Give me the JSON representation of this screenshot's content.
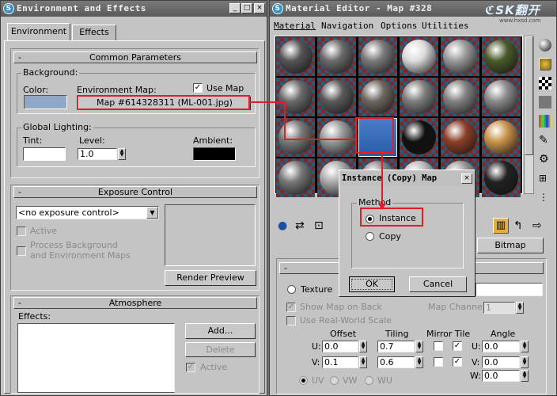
{
  "env": {
    "title": "Environment and Effects",
    "tabs": [
      "Environment",
      "Effects"
    ],
    "common": {
      "header": "Common Parameters",
      "background_group": "Background:",
      "color_label": "Color:",
      "env_map_label": "Environment Map:",
      "use_map_label": "Use Map",
      "use_map_checked": true,
      "map_button": "Map #614328311 (ML-001.jpg)",
      "global_lighting_group": "Global Lighting:",
      "tint_label": "Tint:",
      "level_label": "Level:",
      "level_value": "1.0",
      "ambient_label": "Ambient:",
      "bg_color": "#8fa8c8",
      "tint_color": "#ffffff",
      "ambient_color": "#000000"
    },
    "exposure": {
      "header": "Exposure Control",
      "dropdown_value": "<no exposure control>",
      "active_label": "Active",
      "process_bg_label_1": "Process Background",
      "process_bg_label_2": "and Environment Maps",
      "render_preview_label": "Render Preview"
    },
    "atmosphere": {
      "header": "Atmosphere",
      "effects_label": "Effects:",
      "add_label": "Add...",
      "delete_label": "Delete",
      "active_label": "Active"
    }
  },
  "mat": {
    "title": "Material Editor - Map #328",
    "menu": [
      "Material",
      "Navigation",
      "Options",
      "Utilities"
    ],
    "watermark_1": "ℭSK翻开",
    "watermark_2": "www.hxsd.com",
    "slot_colors": [
      [
        "#555555",
        "#6a6a6a",
        "#7a7a7a",
        "#dcdcdc",
        "#9a9a9a",
        "#4a5a2a"
      ],
      [
        "#6a6a6a",
        "#5a5a5a",
        "#6e6660",
        "#7e7e7e",
        "#828282",
        "#8a8a8a"
      ],
      [
        "#7a7a7a",
        "#9a9a9a",
        "#2a5ba8",
        "#111111",
        "#8a4028",
        "#c8944a"
      ],
      [
        "#777777",
        "#aaaaaa",
        "#888888",
        "#bbbbbb",
        "#999999",
        "#222222"
      ]
    ],
    "bitmap_label": "Bitmap",
    "texture_label": "Texture",
    "show_map_label": "Show Map on Back",
    "map_channel_label": "Map Channel:",
    "map_channel_value": "1",
    "real_world_label": "Use Real-World Scale",
    "offset_label": "Offset",
    "tiling_label": "Tiling",
    "mirror_tile_label": "Mirror Tile",
    "angle_label": "Angle",
    "u_label": "U:",
    "v_label": "V:",
    "w_label": "W:",
    "u_offset": "0.0",
    "v_offset": "0.1",
    "u_tiling": "0.7",
    "v_tiling": "0.6",
    "u_angle": "0.0",
    "v_angle": "0.0",
    "w_angle": "0.0",
    "uv_label": "UV",
    "vw_label": "VW",
    "wu_label": "WU"
  },
  "dialog": {
    "title": "Instance (Copy) Map",
    "method_label": "Method",
    "instance_label": "Instance",
    "copy_label": "Copy",
    "ok_label": "OK",
    "cancel_label": "Cancel"
  },
  "accent": "#e21d2a"
}
